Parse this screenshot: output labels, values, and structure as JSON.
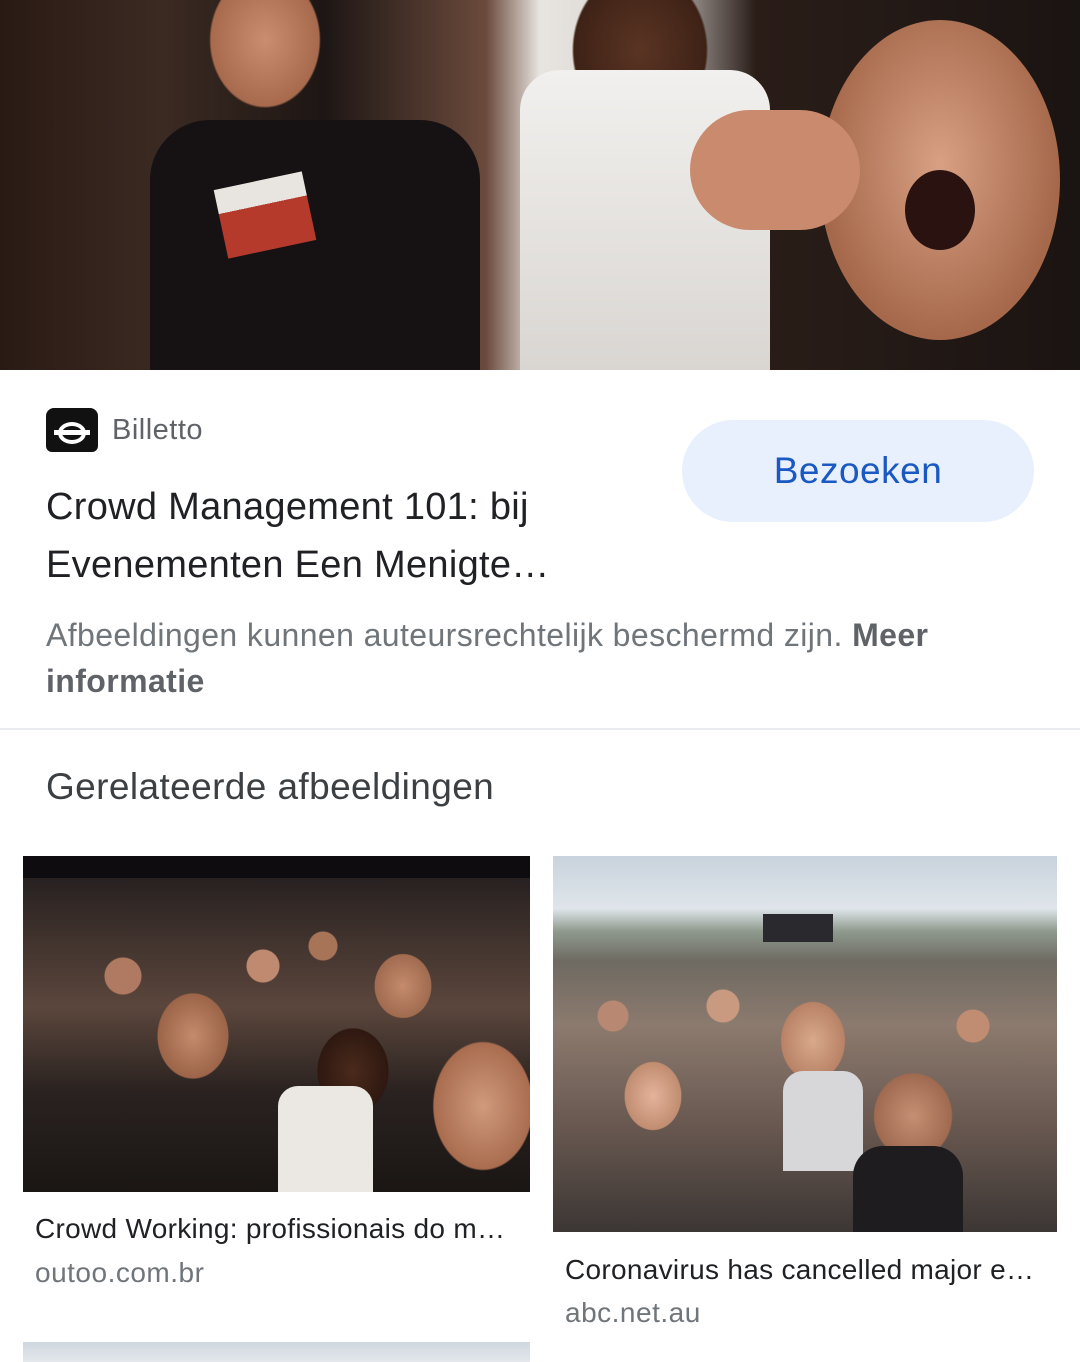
{
  "preview": {
    "image_alt": "crowd-photo",
    "source_name": "Billetto",
    "source_icon": "billetto-logo",
    "title_line1": "Crowd Management 101: bij",
    "title_line2": "Evenementen Een Menigte…",
    "visit_label": "Bezoeken",
    "copyright_text": "Afbeeldingen kunnen auteursrechtelijk beschermd zijn.",
    "more_info_label": "Meer informatie"
  },
  "related": {
    "heading": "Gerelateerde afbeeldingen",
    "items": [
      {
        "title": "Crowd Working: profissionais do m…",
        "source": "outoo.com.br"
      },
      {
        "title": "Coronavirus has cancelled major e…",
        "source": "abc.net.au"
      }
    ]
  },
  "colors": {
    "accent": "#1a58c2",
    "button_bg": "#e8f0fe",
    "text_primary": "#202124",
    "text_secondary": "#70757a"
  }
}
